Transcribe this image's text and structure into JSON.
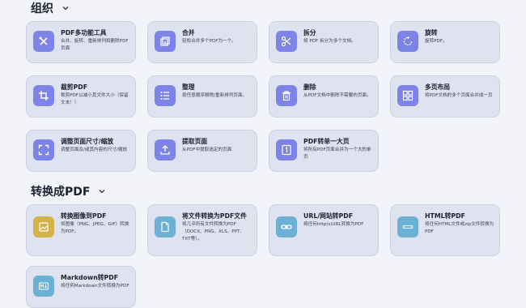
{
  "sections": [
    {
      "title": "组织",
      "cards": [
        {
          "icon": "tools-icon",
          "title": "PDF多功能工具",
          "desc": "合并、旋转、重新排列和删除PDF页面"
        },
        {
          "icon": "merge-icon",
          "title": "合并",
          "desc": "轻松合并多个PDF为一个。"
        },
        {
          "icon": "scissors-icon",
          "title": "拆分",
          "desc": "将 PDF 拆分为多个文档。"
        },
        {
          "icon": "rotate-icon",
          "title": "旋转",
          "desc": "旋转PDF。"
        },
        {
          "icon": "crop-icon",
          "title": "裁剪PDF",
          "desc": "裁剪PDF以减小其文件大小（保留文本！）"
        },
        {
          "icon": "list-icon",
          "title": "整理",
          "desc": "按任意顺序删除/重新排列页面。"
        },
        {
          "icon": "trash-icon",
          "title": "删除",
          "desc": "从PDF文档中删除不需要的页面。"
        },
        {
          "icon": "grid-icon",
          "title": "多页布局",
          "desc": "将PDF文档的多个页面合并成一页"
        },
        {
          "icon": "scale-icon",
          "title": "调整页面尺寸/缩放",
          "desc": "调整页面及/或其内容的尺寸/缩放"
        },
        {
          "icon": "upload-icon",
          "title": "提取页面",
          "desc": "从PDF中提取选定的页面"
        },
        {
          "icon": "single-page-icon",
          "title": "PDF转单一大页",
          "desc": "将所有PDF页面合并为一个大的单页"
        }
      ]
    },
    {
      "title": "转换成PDF",
      "cards": [
        {
          "icon": "image-icon",
          "title": "转换图像到PDF",
          "desc": "将图像（PNG、JPEG、GIF）转换为PDF。"
        },
        {
          "icon": "file-icon",
          "title": "将文件转换为PDF文件",
          "desc": "将几乎所有文件转换为PDF（DOCX、PNG、XLS、PPT、TXT等）。"
        },
        {
          "icon": "link-icon",
          "title": "URL/网站转PDF",
          "desc": "将任何http(s)URL转换为PDF"
        },
        {
          "icon": "html-icon",
          "title": "HTML转PDF",
          "desc": "将任何HTML文件或zip文件转换为PDF"
        },
        {
          "icon": "markdown-icon",
          "title": "Markdown转PDF",
          "desc": "将任何Markdown文件转换为PDF"
        }
      ]
    }
  ],
  "colors": {
    "purple": "#7d84e8",
    "gold": "#d4b24a",
    "blue": "#6cb0d6",
    "card_bg": "#dfe3ef",
    "page_bg": "#f2f4fa"
  }
}
